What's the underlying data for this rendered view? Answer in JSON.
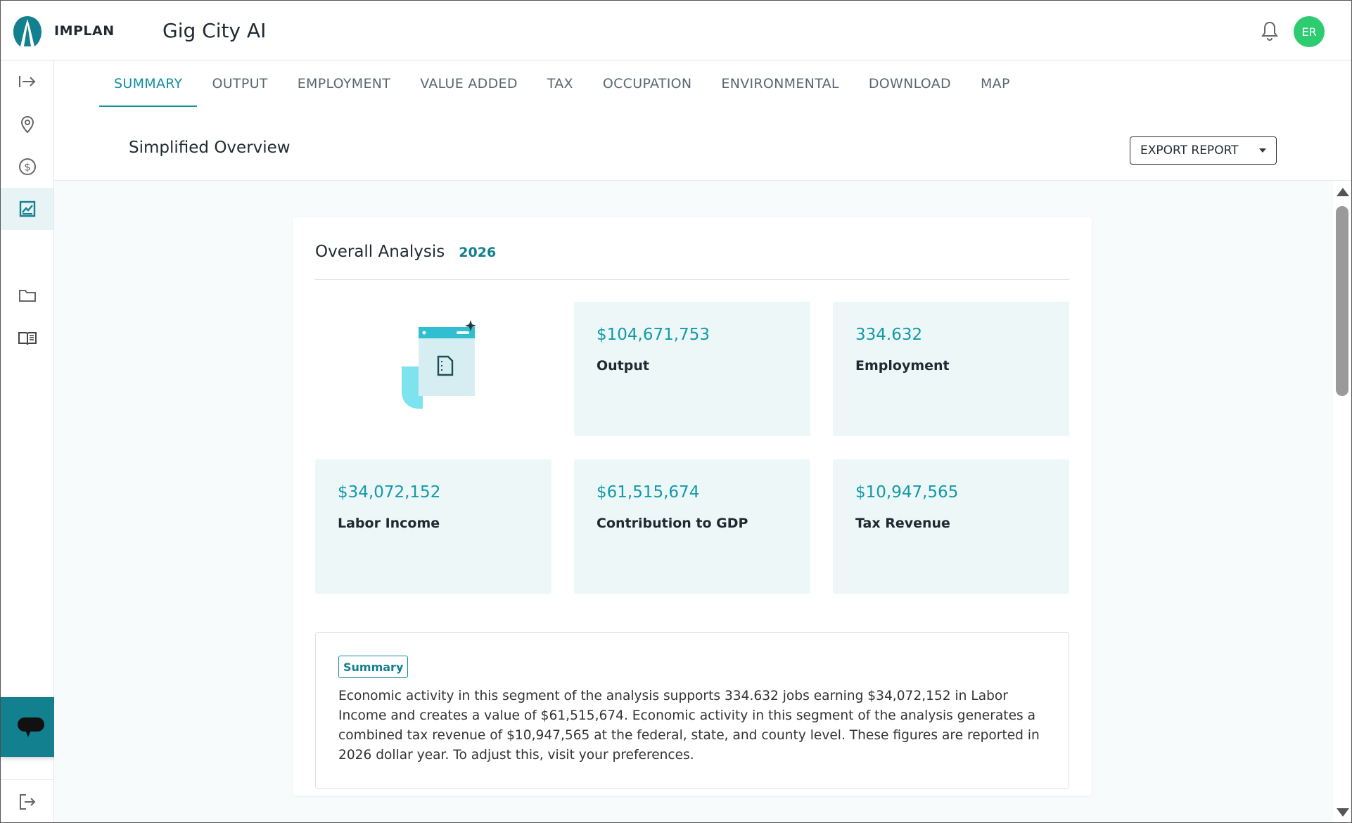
{
  "app": {
    "brand": "IMPLAN",
    "project_title": "Gig City AI"
  },
  "user": {
    "initials": "ER",
    "avatar_color": "#2ecc71"
  },
  "colors": {
    "accent": "#12909f",
    "card_bg": "#edf7f8",
    "chat_button": "#13808f"
  },
  "nav_rail": [
    {
      "icon": "expand-sidebar-icon"
    },
    {
      "icon": "location-pin-icon"
    },
    {
      "icon": "dollar-circle-icon"
    },
    {
      "icon": "chart-icon",
      "active": true
    },
    {
      "icon": "folder-icon"
    },
    {
      "icon": "book-icon"
    },
    {
      "icon": "logout-icon"
    }
  ],
  "tabs": [
    {
      "label": "SUMMARY",
      "active": true
    },
    {
      "label": "OUTPUT"
    },
    {
      "label": "EMPLOYMENT"
    },
    {
      "label": "VALUE ADDED"
    },
    {
      "label": "TAX"
    },
    {
      "label": "OCCUPATION"
    },
    {
      "label": "ENVIRONMENTAL"
    },
    {
      "label": "DOWNLOAD"
    },
    {
      "label": "MAP"
    }
  ],
  "section": {
    "title": "Simplified Overview",
    "export_label": "EXPORT REPORT"
  },
  "overall": {
    "title": "Overall Analysis",
    "year": "2026",
    "metrics": [
      {
        "value": "$104,671,753",
        "label": "Output"
      },
      {
        "value": "334.632",
        "label": "Employment"
      },
      {
        "value": "$34,072,152",
        "label": "Labor Income"
      },
      {
        "value": "$61,515,674",
        "label": "Contribution to GDP"
      },
      {
        "value": "$10,947,565",
        "label": "Tax Revenue"
      }
    ]
  },
  "summary": {
    "tag": "Summary",
    "text": "Economic activity in this segment of the analysis supports 334.632 jobs earning $34,072,152 in Labor Income and creates a value of $61,515,674. Economic activity in this segment of the analysis generates a combined tax revenue of $10,947,565 at the federal, state, and county level. These figures are reported in 2026 dollar year. To adjust this, visit your preferences."
  }
}
